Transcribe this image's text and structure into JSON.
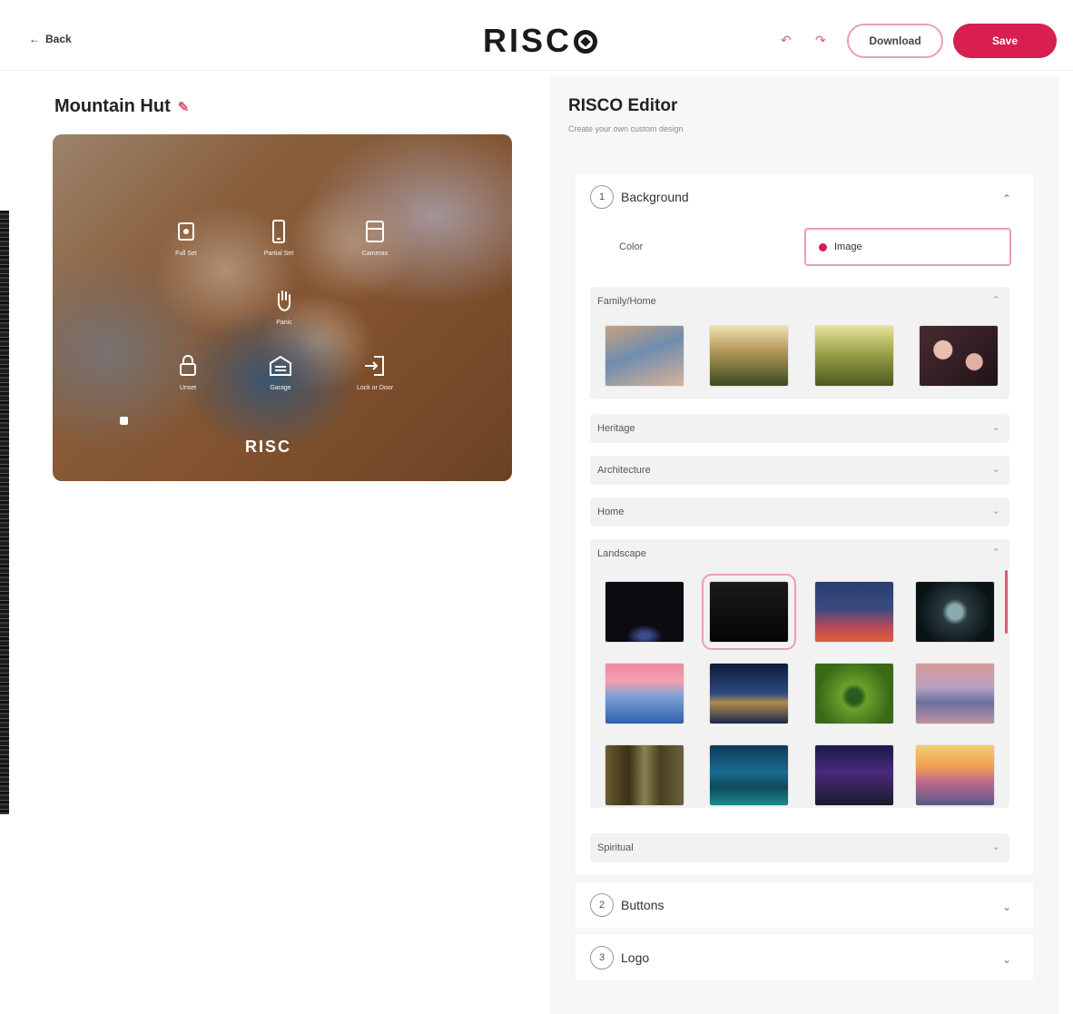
{
  "header": {
    "back_label": "Back",
    "logo_text": "RISC",
    "undo_icon": "undo-icon",
    "redo_icon": "redo-icon",
    "download_label": "Download",
    "save_label": "Save",
    "accent_color": "#d81f4f"
  },
  "design": {
    "title": "Mountain Hut",
    "edit_icon": "pencil-icon"
  },
  "panel_preview": {
    "tiles": [
      {
        "icon": "alarm-icon",
        "label": "Full Set"
      },
      {
        "icon": "phone-icon",
        "label": "Partial Set"
      },
      {
        "icon": "camera-icon",
        "label": "Cameras"
      },
      {
        "icon": "hand-icon",
        "label": "Panic"
      },
      {
        "icon": "lock-icon",
        "label": "Unset"
      },
      {
        "icon": "garage-icon",
        "label": "Garage"
      },
      {
        "icon": "login-icon",
        "label": "Lock or Door"
      }
    ],
    "logo_text": "RISC"
  },
  "editor": {
    "title": "RISCO Editor",
    "subtitle": "Create your own custom design",
    "sections": [
      {
        "num": "1",
        "label": "Background"
      },
      {
        "num": "2",
        "label": "Buttons"
      },
      {
        "num": "3",
        "label": "Logo"
      }
    ],
    "background": {
      "toggle_color": "Color",
      "toggle_image": "Image",
      "categories": [
        "Family/Home",
        "Heritage",
        "Architecture",
        "Home",
        "Landscape",
        "Spiritual"
      ]
    }
  }
}
